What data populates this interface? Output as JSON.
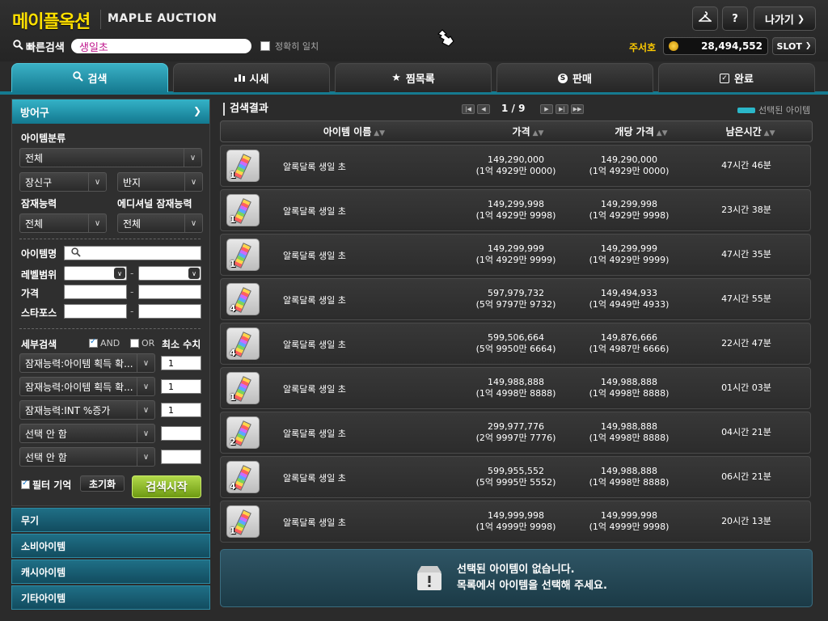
{
  "header": {
    "logo": "메이플옥션",
    "logo_en": "MAPLE AUCTION",
    "quick_search_label": "빠른검색",
    "quick_search_value": "생일초",
    "exact_match_label": "정확히 일치",
    "exit_label": "나가기",
    "help_label": "?",
    "owner_label": "주서호",
    "meso": "28,494,552",
    "slot_label": "SLOT"
  },
  "tabs": [
    {
      "label": "검색",
      "icon": "search-icon",
      "active": true
    },
    {
      "label": "시세",
      "icon": "bar-chart-icon"
    },
    {
      "label": "찜목록",
      "icon": "star-icon"
    },
    {
      "label": "판매",
      "icon": "coin-icon"
    },
    {
      "label": "완료",
      "icon": "check-icon"
    }
  ],
  "filter": {
    "category_title": "방어구",
    "item_class_label": "아이템분류",
    "item_class_value": "전체",
    "sub1_value": "장신구",
    "sub2_value": "반지",
    "potential_label": "잠재능력",
    "potential_value": "전체",
    "add_potential_label": "에디셔널 잠재능력",
    "add_potential_value": "전체",
    "item_name_label": "아이템명",
    "level_label": "레벨범위",
    "price_label": "가격",
    "starforce_label": "스타포스",
    "range_dash": "-",
    "detail_search_label": "세부검색",
    "and_label": "AND",
    "or_label": "OR",
    "min_value_label": "최소 수치",
    "options": [
      {
        "label": "잠재능력:아이템 획득 확...",
        "value": "1"
      },
      {
        "label": "잠재능력:아이템 획득 확...",
        "value": "1"
      },
      {
        "label": "잠재능력:INT %증가",
        "value": "1"
      },
      {
        "label": "선택 안 함",
        "value": ""
      },
      {
        "label": "선택 안 함",
        "value": ""
      }
    ],
    "filter_memory_label": "필터 기억",
    "reset_label": "초기화",
    "search_start_label": "검색시작"
  },
  "categories": [
    "무기",
    "소비아이템",
    "캐시아이템",
    "기타아이템"
  ],
  "results": {
    "title": "검색결과",
    "page": "1 / 9",
    "selected_legend": "선택된 아이템",
    "columns": [
      "아이템 이름",
      "가격",
      "개당 가격",
      "남은시간"
    ],
    "rows": [
      {
        "count": "1",
        "name": "알록달록 생일 초",
        "price": "149,290,000",
        "price_kr": "(1억 4929만 0000)",
        "unit": "149,290,000",
        "unit_kr": "(1억 4929만 0000)",
        "time": "47시간 46분"
      },
      {
        "count": "1",
        "name": "알록달록 생일 초",
        "price": "149,299,998",
        "price_kr": "(1억 4929만 9998)",
        "unit": "149,299,998",
        "unit_kr": "(1억 4929만 9998)",
        "time": "23시간 38분"
      },
      {
        "count": "1",
        "name": "알록달록 생일 초",
        "price": "149,299,999",
        "price_kr": "(1억 4929만 9999)",
        "unit": "149,299,999",
        "unit_kr": "(1억 4929만 9999)",
        "time": "47시간 35분"
      },
      {
        "count": "4",
        "name": "알록달록 생일 초",
        "price": "597,979,732",
        "price_kr": "(5억 9797만 9732)",
        "unit": "149,494,933",
        "unit_kr": "(1억 4949만 4933)",
        "time": "47시간 55분"
      },
      {
        "count": "4",
        "name": "알록달록 생일 초",
        "price": "599,506,664",
        "price_kr": "(5억 9950만 6664)",
        "unit": "149,876,666",
        "unit_kr": "(1억 4987만 6666)",
        "time": "22시간 47분"
      },
      {
        "count": "1",
        "name": "알록달록 생일 초",
        "price": "149,988,888",
        "price_kr": "(1억 4998만 8888)",
        "unit": "149,988,888",
        "unit_kr": "(1억 4998만 8888)",
        "time": "01시간 03분"
      },
      {
        "count": "2",
        "name": "알록달록 생일 초",
        "price": "299,977,776",
        "price_kr": "(2억 9997만 7776)",
        "unit": "149,988,888",
        "unit_kr": "(1억 4998만 8888)",
        "time": "04시간 21분"
      },
      {
        "count": "4",
        "name": "알록달록 생일 초",
        "price": "599,955,552",
        "price_kr": "(5억 9995만 5552)",
        "unit": "149,988,888",
        "unit_kr": "(1억 4998만 8888)",
        "time": "06시간 21분"
      },
      {
        "count": "1",
        "name": "알록달록 생일 초",
        "price": "149,999,998",
        "price_kr": "(1억 4999만 9998)",
        "unit": "149,999,998",
        "unit_kr": "(1억 4999만 9998)",
        "time": "20시간 13분"
      }
    ]
  },
  "detail": {
    "line1": "선택된 아이템이 없습니다.",
    "line2": "목록에서 아이템을 선택해 주세요."
  }
}
